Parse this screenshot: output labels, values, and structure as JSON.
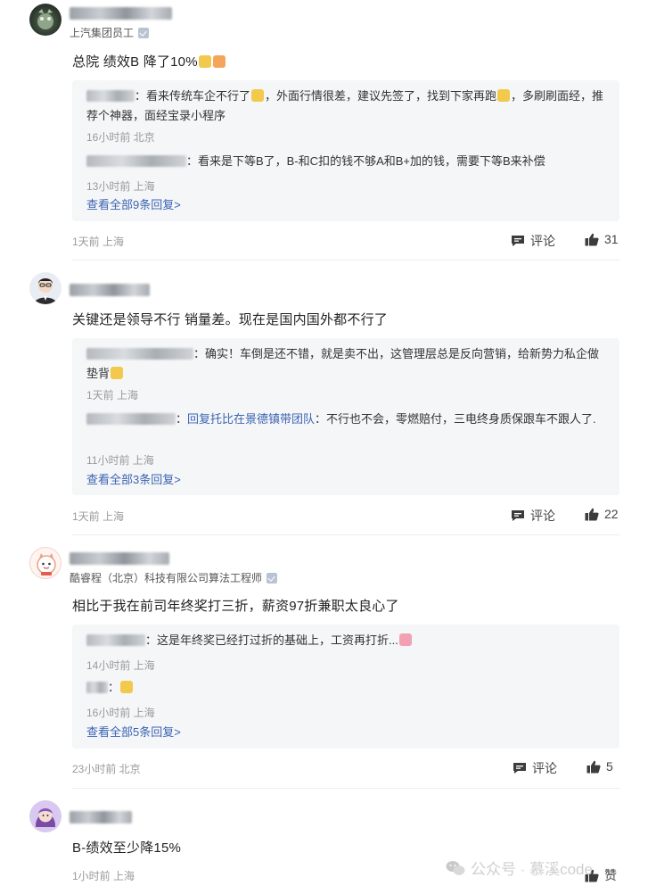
{
  "comments": [
    {
      "user_title": "上汽集团员工",
      "content": "总院 绩效B 降了10%",
      "replies": [
        {
          "text": "看来传统车企不行了",
          "text2": "，外面行情很差，建议先签了，找到下家再跑",
          "text3": "，多刷刷面经，推荐个神器，面经宝录小程序",
          "meta": "16小时前 北京"
        },
        {
          "text": "看来是下等B了，B-和C扣的钱不够A和B+加的钱，需要下等B来补偿",
          "meta": "13小时前 上海"
        }
      ],
      "view_all": "查看全部9条回复>",
      "meta": "1天前 上海",
      "comment_label": "评论",
      "likes": "31"
    },
    {
      "user_title": "",
      "content": "关键还是领导不行 销量差。现在是国内国外都不行了",
      "replies": [
        {
          "text": "确实！车倒是还不错，就是卖不出，这管理层总是反向营销，给新势力私企做垫背",
          "meta": "1天前 上海"
        },
        {
          "reply_to": "回复托比在景德镇带团队",
          "text": "不行也不会，零燃赔付，三电终身质保跟车不跟人了.",
          "meta": "11小时前 上海"
        }
      ],
      "view_all": "查看全部3条回复>",
      "meta": "1天前 上海",
      "comment_label": "评论",
      "likes": "22"
    },
    {
      "user_title": "酷睿程（北京）科技有限公司算法工程师",
      "content": "相比于我在前司年终奖打三折，薪资97折兼职太良心了",
      "replies": [
        {
          "text": "这是年终奖已经打过折的基础上，工资再打折...",
          "meta": "14小时前 上海"
        },
        {
          "text": "",
          "meta": "16小时前 上海"
        }
      ],
      "view_all": "查看全部5条回复>",
      "meta": "23小时前 北京",
      "comment_label": "评论",
      "likes": "5"
    },
    {
      "user_title": "",
      "content": "B-绩效至少降15%",
      "meta": "1小时前 上海",
      "like_label": "赞"
    }
  ],
  "watermark": "公众号 · 慕溪code",
  "colors": {
    "reply_bg": "#f5f6f7",
    "link": "#3b64b5",
    "meta": "#9a9a9a"
  }
}
